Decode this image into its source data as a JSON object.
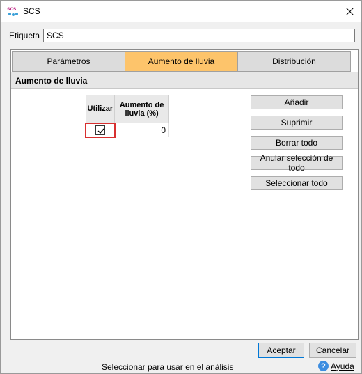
{
  "window": {
    "title": "SCS",
    "app_icon_text": "scs",
    "close_icon": "close-icon"
  },
  "etiqueta": {
    "label": "Etiqueta",
    "value": "SCS"
  },
  "tabs": [
    {
      "label": "Parámetros",
      "active": false
    },
    {
      "label": "Aumento de lluvia",
      "active": true
    },
    {
      "label": "Distribución",
      "active": false
    }
  ],
  "section": {
    "title": "Aumento de lluvia"
  },
  "grid": {
    "headers": [
      "Utilizar",
      "Aumento de lluvia (%)"
    ],
    "rows": [
      {
        "utilizar": true,
        "aumento": "0"
      }
    ]
  },
  "side_buttons": [
    "Añadir",
    "Suprimir",
    "Borrar todo",
    "Anular selección de todo",
    "Seleccionar todo"
  ],
  "footer": {
    "accept": "Aceptar",
    "cancel": "Cancelar",
    "status": "Seleccionar para usar en el análisis",
    "help": "Ayuda"
  },
  "colors": {
    "active_tab": "#fdc46b",
    "checkbox_highlight": "#d83030",
    "help_icon": "#3c8de0"
  }
}
